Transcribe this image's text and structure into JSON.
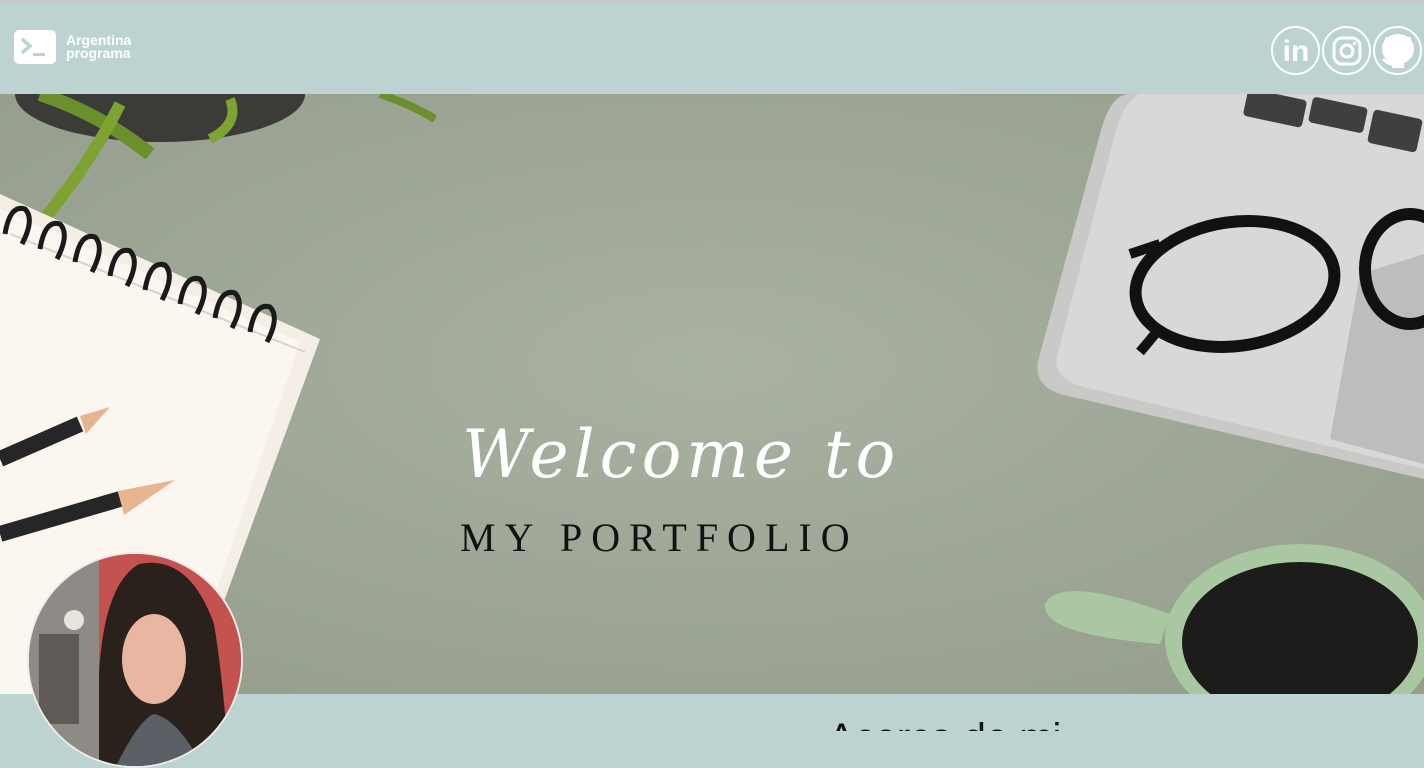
{
  "brand": {
    "line1": "Argentina",
    "line2": "programa"
  },
  "social": [
    {
      "name": "linkedin",
      "label": "in"
    },
    {
      "name": "instagram",
      "label": ""
    },
    {
      "name": "github",
      "label": ""
    }
  ],
  "hero": {
    "title": "Welcome to",
    "subtitle": "MY PORTFOLIO"
  },
  "about": {
    "title": "Acerca de mi"
  },
  "colors": {
    "header_bg": "#bcd3d1",
    "hero_bg": "#a3ac9b",
    "white": "#ffffff"
  }
}
